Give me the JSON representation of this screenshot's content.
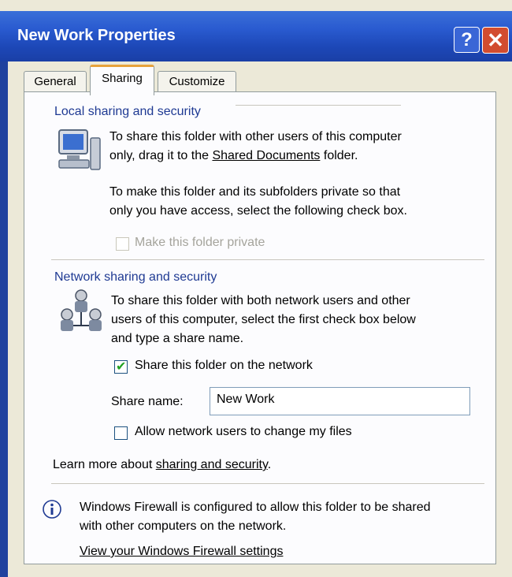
{
  "window": {
    "title": "New Work Properties",
    "help_glyph": "?",
    "close_glyph": "✕"
  },
  "tabs": [
    {
      "label": "General"
    },
    {
      "label": "Sharing"
    },
    {
      "label": "Customize"
    }
  ],
  "local": {
    "group_label": "Local sharing and security",
    "desc_line1_pre": "To share this folder with other users of this computer",
    "desc_line2_pre": "only, drag it to the ",
    "shared_docs_link": "Shared Documents",
    "desc_line2_post": " folder.",
    "private_line1": "To make this folder and its subfolders private so that",
    "private_line2": "only you have access, select the following check box.",
    "private_checkbox_label": "Make this folder private"
  },
  "network": {
    "group_label": "Network sharing and security",
    "desc_line1": "To share this folder with both network users and other",
    "desc_line2": "users of this computer, select the first check box below",
    "desc_line3": "and type a share name.",
    "share_checkbox_label": "Share this folder on the network",
    "share_checked": true,
    "share_name_label": "Share name:",
    "share_name_value": "New Work",
    "allow_checkbox_label": "Allow network users to change my files",
    "allow_checked": false
  },
  "learn_more": {
    "prefix": "Learn more about ",
    "link": "sharing and security",
    "suffix": "."
  },
  "firewall": {
    "line1": "Windows Firewall is configured to allow this folder to be shared",
    "line2": "with other computers on the network.",
    "settings_link": "View your Windows Firewall settings"
  },
  "colors": {
    "titlebar": "#2a5bd0",
    "group_label": "#1f3a93",
    "active_tab_accent": "#e6a23c",
    "check_mark": "#21a121"
  }
}
